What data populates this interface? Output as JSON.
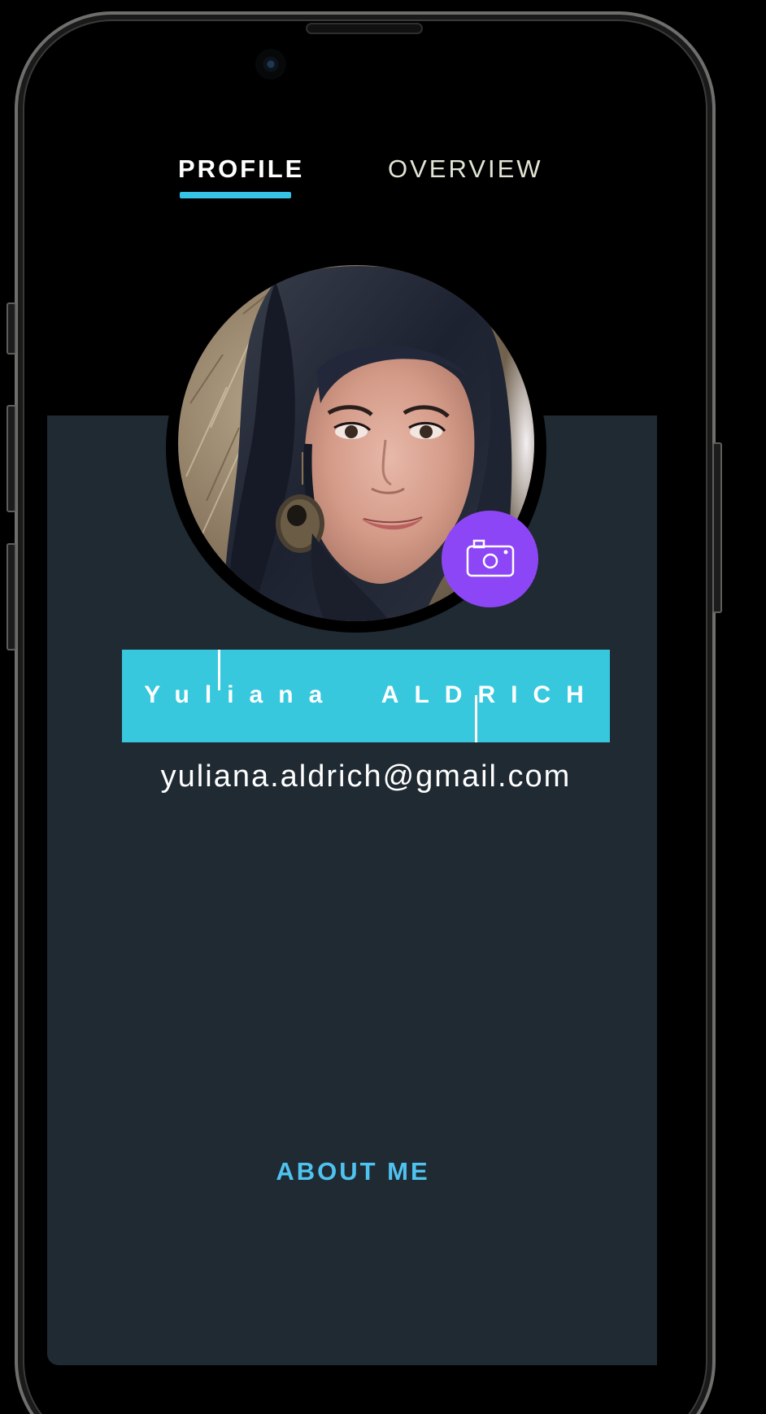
{
  "tabs": {
    "profile_label": "PROFILE",
    "overview_label": "OVERVIEW",
    "active": "PROFILE"
  },
  "profile": {
    "name": "Yuliana  ALDRICH",
    "email": "yuliana.aldrich@gmail.com"
  },
  "sections": {
    "about_heading": "ABOUT ME"
  },
  "icons": {
    "camera_button": "camera-icon"
  },
  "colors": {
    "accent_cyan": "#35c3e6",
    "name_bar": "#37c8de",
    "card_background": "#202a33",
    "camera_button": "#8d46f6",
    "about_heading": "#4fc3f0",
    "screen_background": "#000000"
  }
}
